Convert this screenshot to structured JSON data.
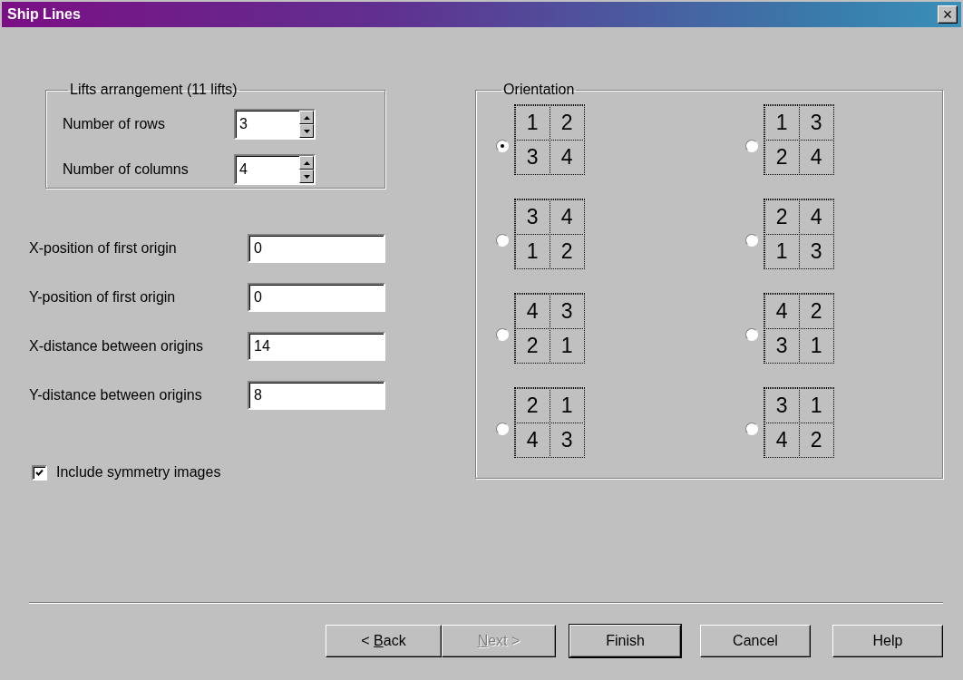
{
  "window": {
    "title": "Ship Lines",
    "close": "×"
  },
  "lifts_group": {
    "title": "Lifts arrangement (11 lifts)",
    "fields": [
      {
        "label": "Number of rows",
        "value": "3"
      },
      {
        "label": "Number of columns",
        "value": "4"
      }
    ]
  },
  "position_fields": [
    {
      "label": "X-position of first origin",
      "value": "0"
    },
    {
      "label": "Y-position of first origin",
      "value": "0"
    },
    {
      "label": "X-distance between origins",
      "value": "14"
    },
    {
      "label": "Y-distance between origins",
      "value": "8"
    }
  ],
  "symmetry_checkbox": {
    "label": "Include symmetry images",
    "checked": true
  },
  "orientation": {
    "title": "Orientation",
    "options": [
      {
        "cells": [
          "1",
          "2",
          "3",
          "4"
        ],
        "selected": true
      },
      {
        "cells": [
          "1",
          "3",
          "2",
          "4"
        ],
        "selected": false
      },
      {
        "cells": [
          "3",
          "4",
          "1",
          "2"
        ],
        "selected": false
      },
      {
        "cells": [
          "2",
          "4",
          "1",
          "3"
        ],
        "selected": false
      },
      {
        "cells": [
          "4",
          "3",
          "2",
          "1"
        ],
        "selected": false
      },
      {
        "cells": [
          "4",
          "2",
          "3",
          "1"
        ],
        "selected": false
      },
      {
        "cells": [
          "2",
          "1",
          "4",
          "3"
        ],
        "selected": false
      },
      {
        "cells": [
          "3",
          "1",
          "4",
          "2"
        ],
        "selected": false
      }
    ]
  },
  "buttons": [
    {
      "prefix": "< ",
      "key": "B",
      "rest": "ack",
      "disabled": false,
      "default": false
    },
    {
      "key": "N",
      "rest": "ext >",
      "disabled": true,
      "default": false
    },
    {
      "rest": "Finish",
      "disabled": false,
      "default": true
    },
    {
      "rest": "Cancel",
      "disabled": false,
      "default": false
    },
    {
      "rest": "Help",
      "disabled": false,
      "default": false
    }
  ]
}
